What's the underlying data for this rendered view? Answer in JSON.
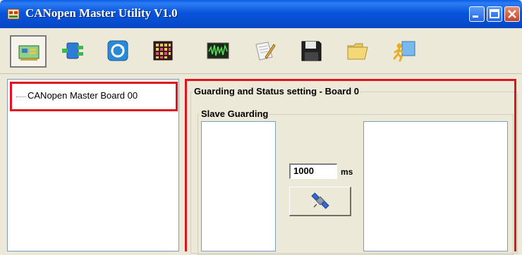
{
  "window": {
    "title": "CANopen Master Utility V1.0",
    "controls": [
      "minimize",
      "maximize",
      "close"
    ]
  },
  "toolbar": {
    "buttons": [
      {
        "icon": "board-config-icon",
        "selected": true
      },
      {
        "icon": "network-node-icon",
        "selected": false
      },
      {
        "icon": "refresh-icon",
        "selected": false
      },
      {
        "icon": "io-matrix-icon",
        "selected": false
      },
      {
        "icon": "waveform-monitor-icon",
        "selected": false
      },
      {
        "icon": "edit-document-icon",
        "selected": false
      },
      {
        "icon": "save-disk-icon",
        "selected": false
      },
      {
        "icon": "open-folder-icon",
        "selected": false
      },
      {
        "icon": "exit-run-icon",
        "selected": false
      }
    ]
  },
  "tree": {
    "items": [
      {
        "label": "CANopen Master Board 00"
      }
    ]
  },
  "main": {
    "group_title": "Guarding and Status setting - Board 0",
    "subgroup_title": "Slave Guarding",
    "interval": {
      "value": "1000",
      "unit": "ms"
    }
  },
  "colors": {
    "highlight_box": "#E0141E",
    "titlebar": "#0855DD",
    "window_bg": "#ECE9D8"
  }
}
